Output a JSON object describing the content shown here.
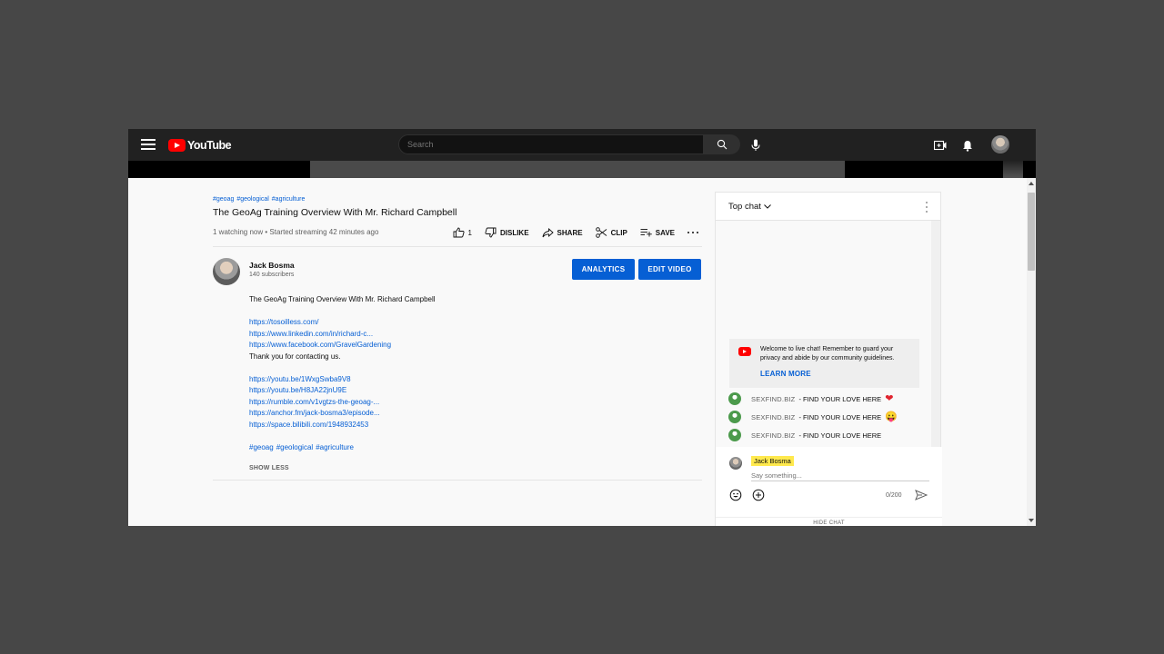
{
  "topbar": {
    "logo_text": "YouTube",
    "search_placeholder": "Search"
  },
  "video": {
    "hashtags": [
      "#geoag",
      "#geological",
      "#agriculture"
    ],
    "title": "The GeoAg Training Overview With Mr. Richard Campbell",
    "meta": "1 watching now • Started streaming 42 minutes ago",
    "like_count": "1",
    "dislike_label": "DISLIKE",
    "share_label": "SHARE",
    "clip_label": "CLIP",
    "save_label": "SAVE"
  },
  "channel": {
    "name": "Jack Bosma",
    "subscribers": "140 subscribers",
    "analytics_label": "ANALYTICS",
    "edit_label": "EDIT VIDEO"
  },
  "description": {
    "intro": "The GeoAg Training Overview With Mr. Richard Campbell",
    "links_1": [
      "https://tosoilless.com/",
      "https://www.linkedin.com/in/richard-c...",
      "https://www.facebook.com/GravelGardening"
    ],
    "thanks": "Thank you for contacting us.",
    "links_2": [
      "https://youtu.be/1WxgSwba9V8",
      "https://youtu.be/H8JA22jnU9E",
      "https://rumble.com/v1vgtzs-the-geoag-...",
      "https://anchor.fm/jack-bosma3/episode...",
      "https://space.bilibili.com/1948932453"
    ],
    "hashtags": [
      "#geoag",
      "#geological",
      "#agriculture"
    ],
    "show_less": "SHOW LESS"
  },
  "chat": {
    "title": "Top chat",
    "welcome_text": "Welcome to live chat! Remember to guard your privacy and abide by our community guidelines.",
    "learn_more": "LEARN MORE",
    "messages": [
      {
        "author": "SEXFIND.BIZ",
        "text": "- FIND YOUR LOVE HERE",
        "emoji": "❤"
      },
      {
        "author": "SEXFIND.BIZ",
        "text": "- FIND YOUR LOVE HERE",
        "emoji": "😛"
      },
      {
        "author": "SEXFIND.BIZ",
        "text": "- FIND YOUR LOVE HERE",
        "emoji": ""
      }
    ],
    "user_name": "Jack Bosma",
    "input_placeholder": "Say something...",
    "char_count": "0/200",
    "hide_chat": "HIDE CHAT"
  },
  "icons": [
    "menu-icon",
    "youtube-logo-icon",
    "search-icon",
    "mic-icon",
    "create-icon",
    "bell-icon",
    "like-icon",
    "dislike-icon",
    "share-icon",
    "clip-icon",
    "save-icon",
    "more-icon",
    "chevron-down-icon",
    "emoji-icon",
    "add-icon",
    "send-icon"
  ],
  "colors": {
    "accent": "#065fd4",
    "brand_red": "#ff0000",
    "topbar": "#212121",
    "highlight": "#ffe94d"
  }
}
